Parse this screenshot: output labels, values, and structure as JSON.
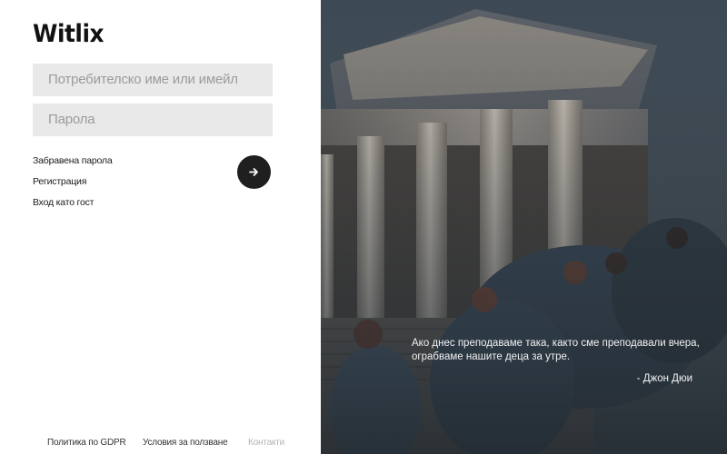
{
  "brand": {
    "name": "Witlix"
  },
  "login": {
    "username_placeholder": "Потребителско име или имейл",
    "password_placeholder": "Парола",
    "submit_icon": "arrow-right-icon"
  },
  "links": {
    "forgot": "Забравена парола",
    "register": "Регистрация",
    "guest": "Вход като гост"
  },
  "footer": {
    "gdpr": "Политика по GDPR",
    "terms": "Условия за ползване",
    "contacts": "Контакти"
  },
  "hero": {
    "quote": "Ако днес преподаваме така, както сме преподавали вчера, ограбваме нашите деца за утре.",
    "author": "- Джон Дюи"
  },
  "colors": {
    "button": "#1f1f1f",
    "field_bg": "#e9e9e9",
    "placeholder": "#9b9b9b"
  }
}
